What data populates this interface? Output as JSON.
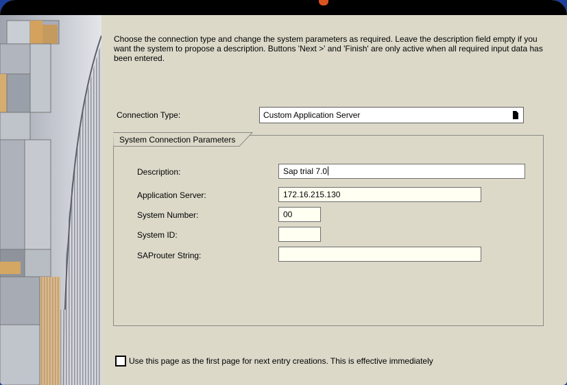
{
  "intro_text": "Choose the connection type and change the system parameters as required. Leave the description field empty if you want the system to propose a description. Buttons 'Next >' and 'Finish' are only active when all required input data has been entered.",
  "connection_type": {
    "label": "Connection Type:",
    "value": "Custom Application Server"
  },
  "group": {
    "title": "System Connection Parameters",
    "fields": {
      "description": {
        "label": "Description:",
        "value": "Sap trial 7.0"
      },
      "app_server": {
        "label": "Application Server:",
        "value": "172.16.215.130"
      },
      "system_number": {
        "label": "System Number:",
        "value": "00"
      },
      "system_id": {
        "label": "System ID:",
        "value": ""
      },
      "saprouter": {
        "label": "SAProuter String:",
        "value": ""
      }
    }
  },
  "first_page_checkbox": {
    "label": "Use this page as the first page for next entry creations. This is effective immediately",
    "checked": false
  },
  "icons": [
    "dropdown-icon",
    "checkbox-icon"
  ],
  "colors": {
    "background": "#dcd9c9",
    "field_bg": "#fffff2",
    "titlebar": "#000000",
    "accent": "#d9541e"
  }
}
